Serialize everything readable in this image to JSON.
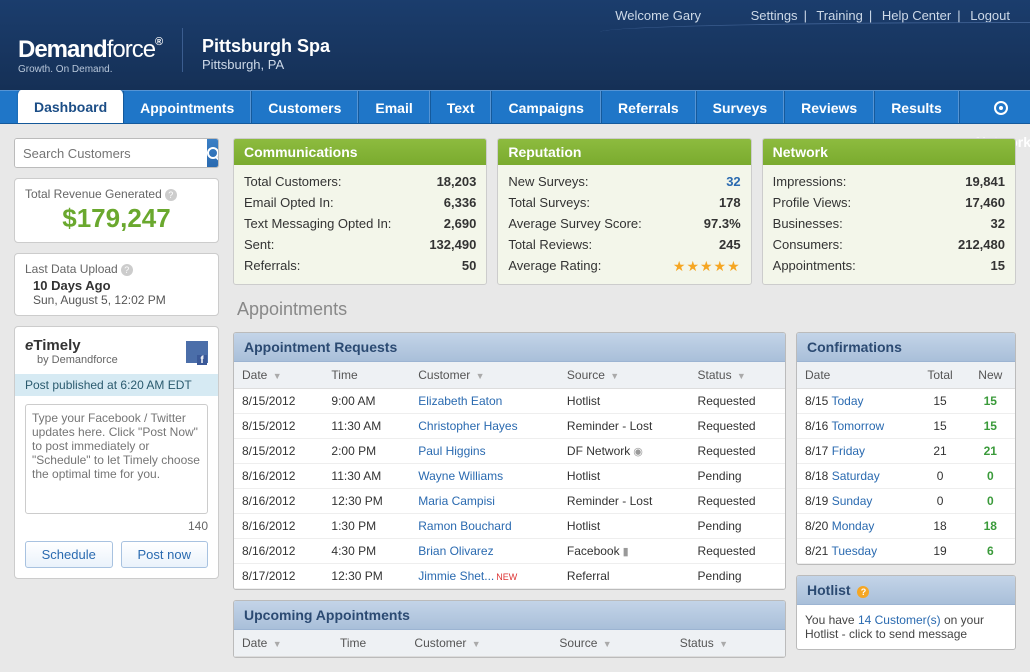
{
  "header": {
    "welcome": "Welcome Gary",
    "links": [
      "Settings",
      "Training",
      "Help Center",
      "Logout"
    ],
    "brand": "Demand",
    "brand2": "force",
    "brand3": "®",
    "tagline": "Growth. On Demand.",
    "company": "Pittsburgh Spa",
    "location": "Pittsburgh, PA"
  },
  "nav": [
    "Dashboard",
    "Appointments",
    "Customers",
    "Email",
    "Text",
    "Campaigns",
    "Referrals",
    "Surveys",
    "Reviews",
    "Results",
    "Network"
  ],
  "search": {
    "placeholder": "Search Customers"
  },
  "revenue": {
    "label": "Total Revenue Generated",
    "value": "$179,247"
  },
  "upload": {
    "label": "Last Data Upload",
    "when": "10 Days Ago",
    "time": "Sun, August 5, 12:02 PM"
  },
  "timely": {
    "title1": "e",
    "title2": "Timely",
    "by": "by Demandforce",
    "status": "Post published at 6:20 AM EDT",
    "placeholder": "Type your Facebook / Twitter updates here. Click \"Post Now\" to post immediately or \"Schedule\" to let Timely choose the optimal time for you.",
    "count": "140",
    "schedule": "Schedule",
    "postnow": "Post now"
  },
  "stats": {
    "comm": {
      "title": "Communications",
      "rows": [
        {
          "l": "Total Customers:",
          "v": "18,203"
        },
        {
          "l": "Email Opted In:",
          "v": "6,336"
        },
        {
          "l": "Text Messaging Opted In:",
          "v": "2,690"
        },
        {
          "l": "Sent:",
          "v": "132,490"
        },
        {
          "l": "Referrals:",
          "v": "50"
        }
      ]
    },
    "rep": {
      "title": "Reputation",
      "rows": [
        {
          "l": "New Surveys:",
          "v": "32",
          "link": true
        },
        {
          "l": "Total Surveys:",
          "v": "178"
        },
        {
          "l": "Average Survey Score:",
          "v": "97.3%"
        },
        {
          "l": "Total Reviews:",
          "v": "245"
        },
        {
          "l": "Average Rating:",
          "stars": true
        }
      ]
    },
    "net": {
      "title": "Network",
      "rows": [
        {
          "l": "Impressions:",
          "v": "19,841"
        },
        {
          "l": "Profile Views:",
          "v": "17,460"
        },
        {
          "l": "Businesses:",
          "v": "32"
        },
        {
          "l": "Consumers:",
          "v": "212,480"
        },
        {
          "l": "Appointments:",
          "v": "15"
        }
      ]
    }
  },
  "appointments": {
    "section": "Appointments",
    "requests": {
      "title": "Appointment Requests",
      "cols": [
        "Date",
        "Time",
        "Customer",
        "Source",
        "Status"
      ],
      "rows": [
        {
          "d": "8/15/2012",
          "t": "9:00 AM",
          "c": "Elizabeth Eaton",
          "s": "Hotlist",
          "st": "Requested"
        },
        {
          "d": "8/15/2012",
          "t": "11:30 AM",
          "c": "Christopher Hayes",
          "s": "Reminder - Lost",
          "st": "Requested"
        },
        {
          "d": "8/15/2012",
          "t": "2:00 PM",
          "c": "Paul Higgins",
          "s": "DF Network",
          "st": "Requested",
          "pin": true
        },
        {
          "d": "8/16/2012",
          "t": "11:30 AM",
          "c": "Wayne Williams",
          "s": "Hotlist",
          "st": "Pending"
        },
        {
          "d": "8/16/2012",
          "t": "12:30 PM",
          "c": "Maria Campisi",
          "s": "Reminder - Lost",
          "st": "Requested"
        },
        {
          "d": "8/16/2012",
          "t": "1:30 PM",
          "c": "Ramon Bouchard",
          "s": "Hotlist",
          "st": "Pending"
        },
        {
          "d": "8/16/2012",
          "t": "4:30 PM",
          "c": "Brian Olivarez",
          "s": "Facebook",
          "st": "Requested",
          "fb": true
        },
        {
          "d": "8/17/2012",
          "t": "12:30 PM",
          "c": "Jimmie Shet...",
          "s": "Referral",
          "st": "Pending",
          "isnew": true
        }
      ]
    },
    "upcoming": {
      "title": "Upcoming Appointments",
      "cols": [
        "Date",
        "Time",
        "Customer",
        "Source",
        "Status"
      ]
    },
    "confirmations": {
      "title": "Confirmations",
      "cols": [
        "Date",
        "Total",
        "New"
      ],
      "rows": [
        {
          "d": "8/15",
          "day": "Today",
          "t": "15",
          "n": "15"
        },
        {
          "d": "8/16",
          "day": "Tomorrow",
          "t": "15",
          "n": "15"
        },
        {
          "d": "8/17",
          "day": "Friday",
          "t": "21",
          "n": "21"
        },
        {
          "d": "8/18",
          "day": "Saturday",
          "t": "0",
          "n": "0"
        },
        {
          "d": "8/19",
          "day": "Sunday",
          "t": "0",
          "n": "0"
        },
        {
          "d": "8/20",
          "day": "Monday",
          "t": "18",
          "n": "18"
        },
        {
          "d": "8/21",
          "day": "Tuesday",
          "t": "19",
          "n": "6"
        }
      ]
    },
    "hotlist": {
      "title": "Hotlist",
      "text1": "You have ",
      "link": "14 Customer(s)",
      "text2": " on your Hotlist - click to send message"
    }
  }
}
